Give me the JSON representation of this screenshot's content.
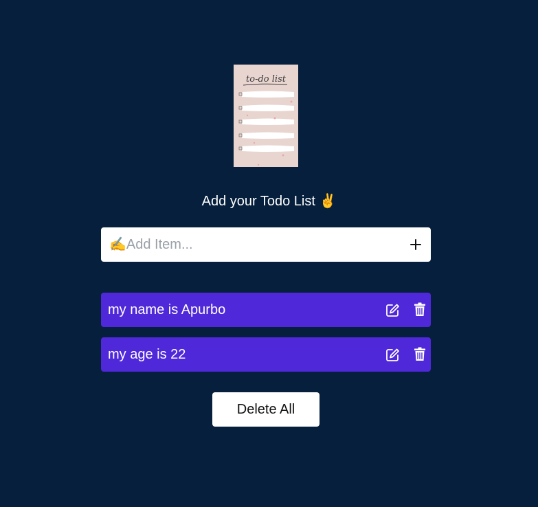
{
  "header": {
    "logo_text": "to-do list",
    "title": "Add your Todo List ✌️"
  },
  "add_item": {
    "placeholder": "✍️Add Item...",
    "add_icon": "plus-icon"
  },
  "todos": [
    {
      "text": "my name is Apurbo",
      "edit_icon": "edit-icon",
      "delete_icon": "trash-icon"
    },
    {
      "text": "my age is 22",
      "edit_icon": "edit-icon",
      "delete_icon": "trash-icon"
    }
  ],
  "footer": {
    "delete_all_label": "Delete All"
  },
  "colors": {
    "background": "#061f3c",
    "item": "#4f28d9",
    "input": "#ffffff"
  }
}
